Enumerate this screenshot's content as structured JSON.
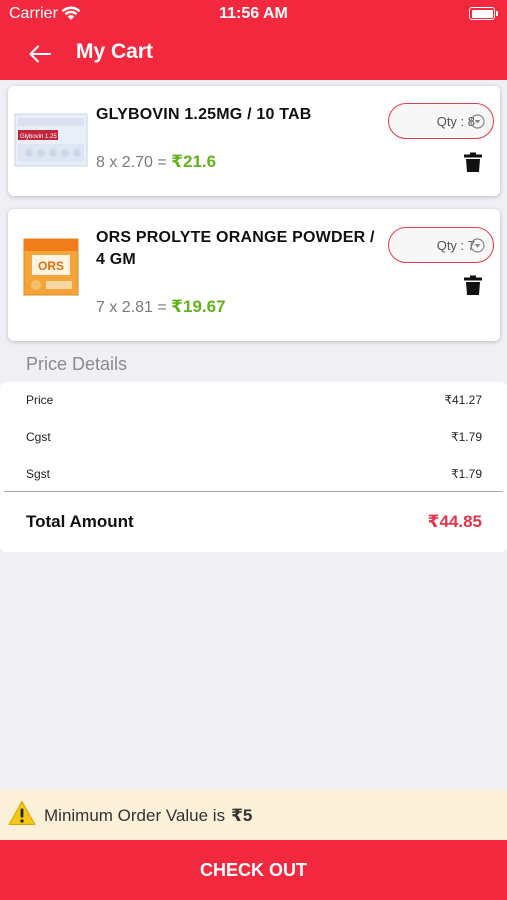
{
  "status_bar": {
    "carrier": "Carrier",
    "time": "11:56 AM"
  },
  "header": {
    "title": "My Cart"
  },
  "cart_items": [
    {
      "name": "GLYBOVIN 1.25MG / 10 TAB",
      "calc": "8 x 2.70 =",
      "total": "₹21.6",
      "qty_label": "Qty : 8",
      "pack_text": "Glybovin 1.25"
    },
    {
      "name": "ORS PROLYTE ORANGE POWDER / 4 GM",
      "calc": "7 x 2.81 =",
      "total": "₹19.67",
      "qty_label": "Qty : 7",
      "pack_text": "ORS"
    }
  ],
  "price_details": {
    "title": "Price Details",
    "rows": [
      {
        "label": "Price",
        "value": "₹41.27"
      },
      {
        "label": "Cgst",
        "value": "₹1.79"
      },
      {
        "label": "Sgst",
        "value": "₹1.79"
      }
    ],
    "total_label": "Total Amount",
    "total_value": "₹44.85"
  },
  "min_order": {
    "text": "Minimum Order Value is",
    "amount": "₹5"
  },
  "checkout_label": "CHECK OUT",
  "colors": {
    "accent": "#f2283f",
    "price_green": "#63b11c",
    "total_red": "#e6334a",
    "banner": "#fbf0d8"
  }
}
